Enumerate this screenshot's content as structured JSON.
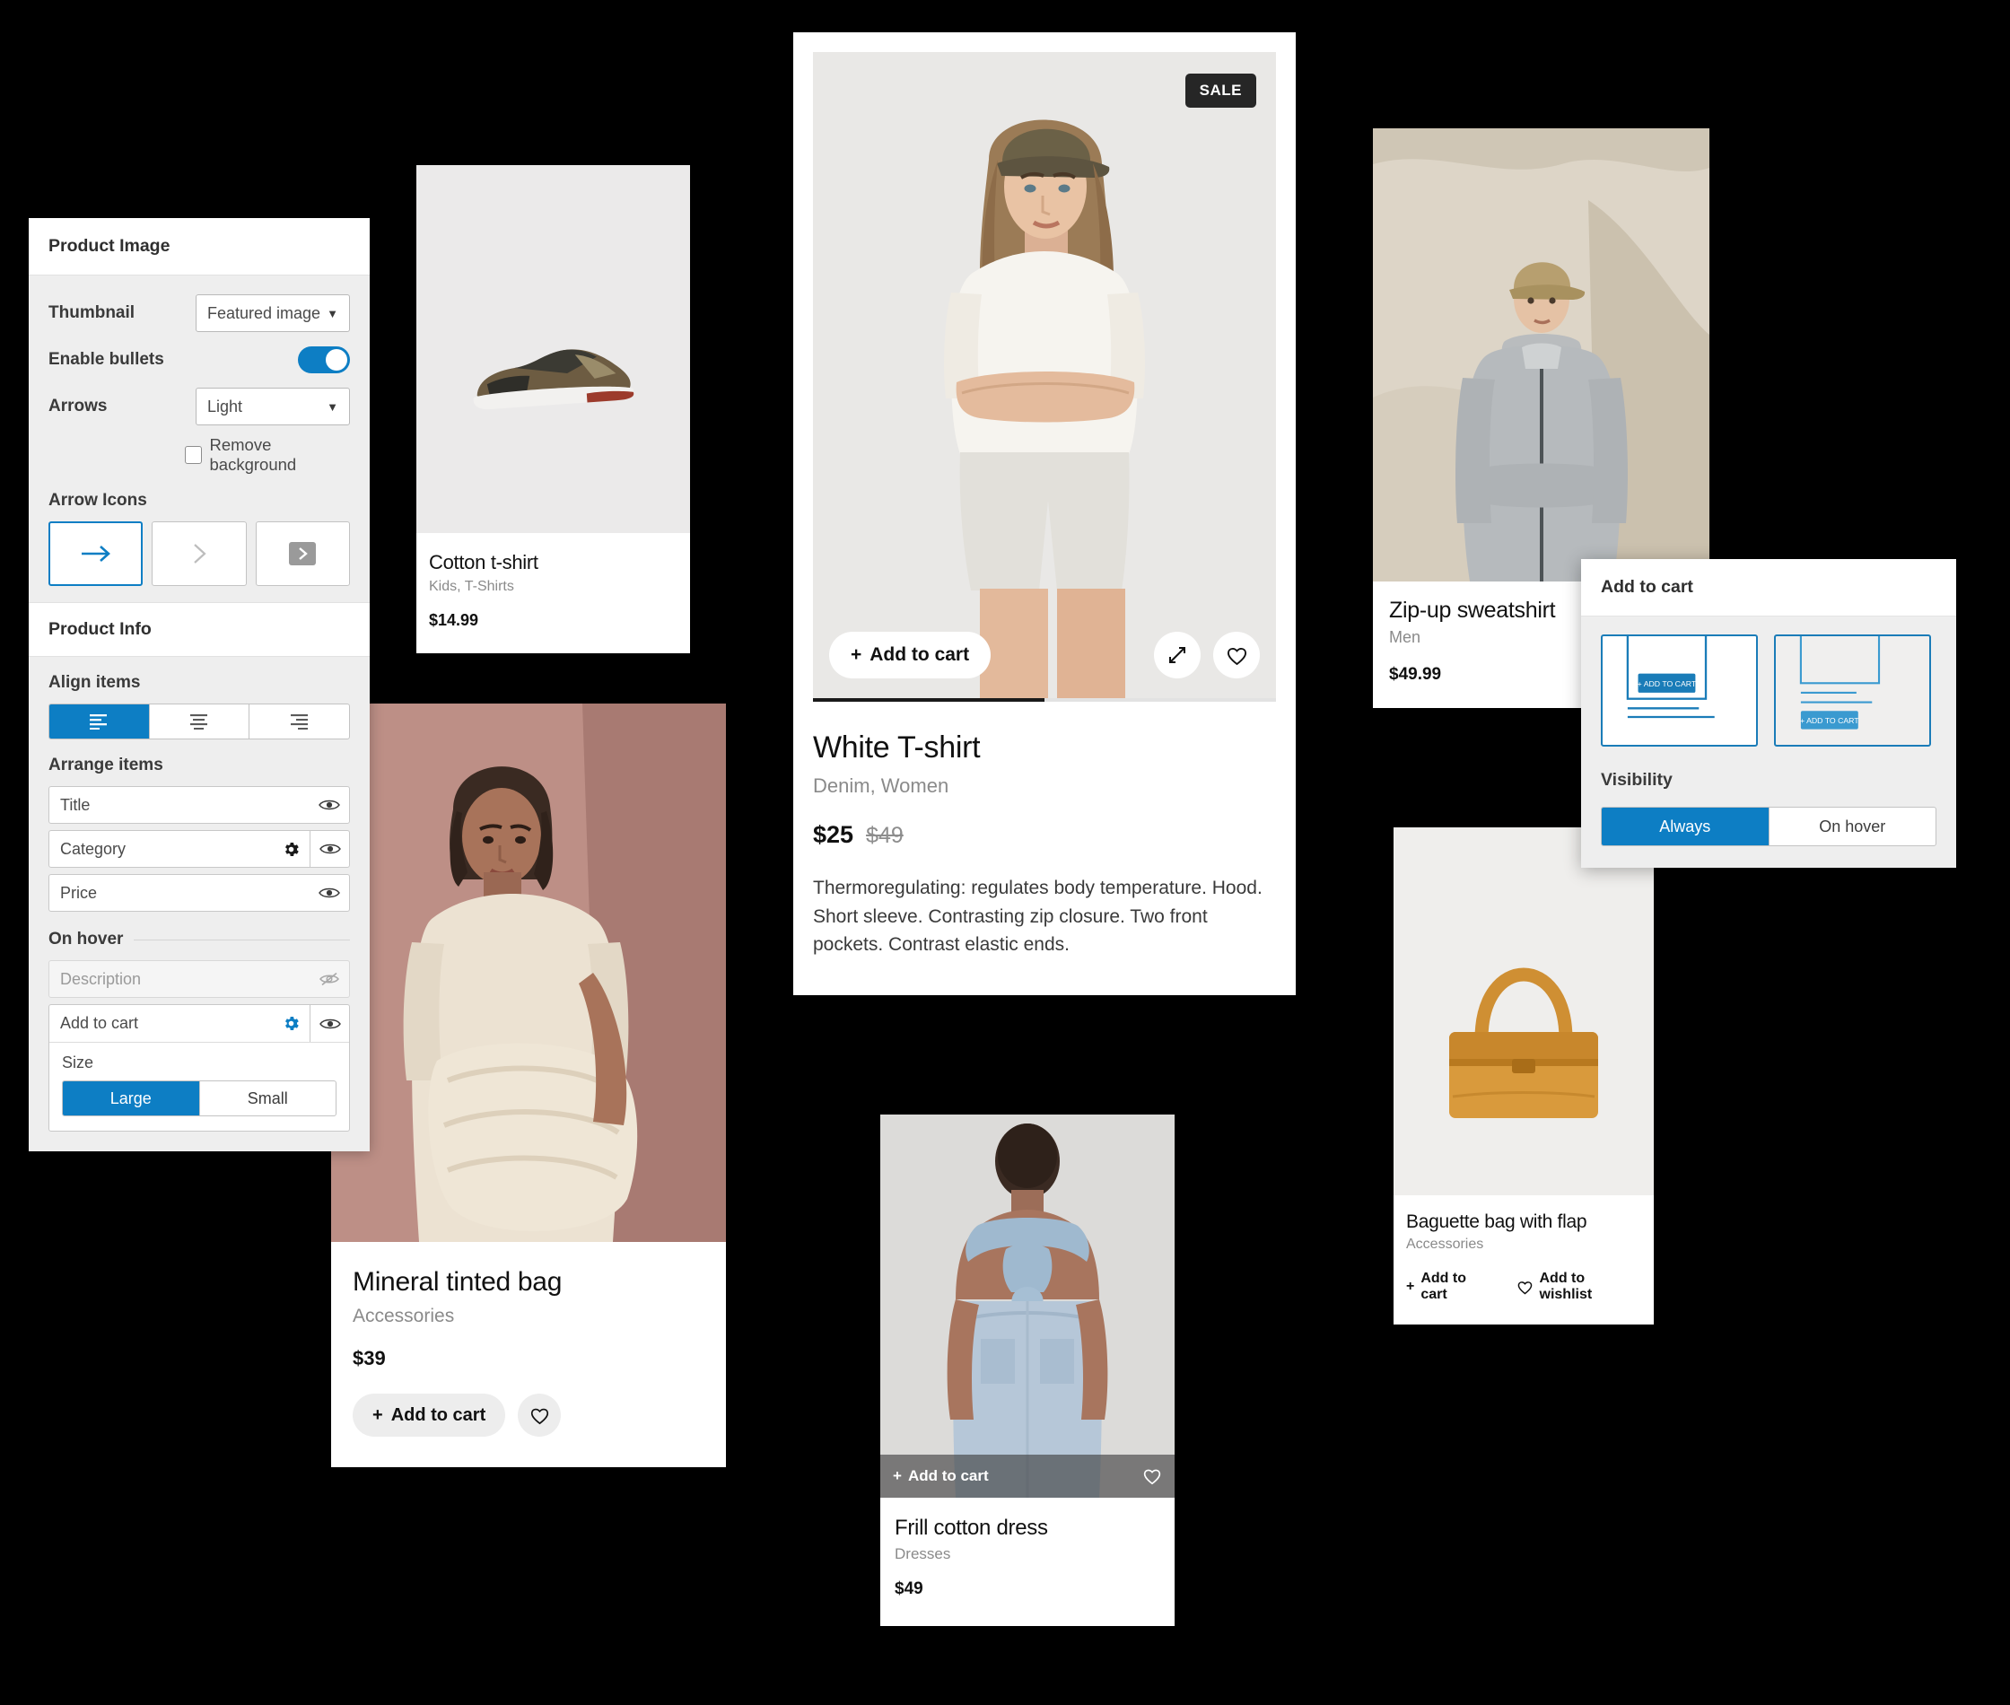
{
  "settings_panel": {
    "header": "Product Image",
    "thumbnail": {
      "label": "Thumbnail",
      "value": "Featured image"
    },
    "enable_bullets": {
      "label": "Enable bullets",
      "state": "on"
    },
    "arrows": {
      "label": "Arrows",
      "value": "Light"
    },
    "remove_background": {
      "label": "Remove background",
      "checked": "false"
    },
    "arrow_icons": {
      "label": "Arrow Icons",
      "options": [
        "long-arrow-right-icon",
        "chevron-right-icon",
        "chevron-right-boxed-icon"
      ],
      "selected_index": 0
    },
    "product_info": {
      "header": "Product Info",
      "align_items": {
        "label": "Align items",
        "options": [
          "align-left-icon",
          "align-center-icon",
          "align-right-icon"
        ],
        "selected_index": 0
      },
      "arrange_items": {
        "label": "Arrange items",
        "items": [
          {
            "name": "Title",
            "has_gear": false,
            "visible": true,
            "dimmed": false
          },
          {
            "name": "Category",
            "has_gear": true,
            "visible": true,
            "dimmed": false
          },
          {
            "name": "Price",
            "has_gear": false,
            "visible": true,
            "dimmed": false
          }
        ]
      },
      "on_hover": {
        "label": "On hover",
        "items": [
          {
            "name": "Description",
            "has_gear": false,
            "visible": false,
            "dimmed": true
          }
        ],
        "add_to_cart": {
          "name": "Add to cart",
          "size_label": "Size",
          "size_options": [
            "Large",
            "Small"
          ],
          "size_selected": "Large"
        }
      }
    }
  },
  "popup": {
    "header": "Add to cart",
    "layout_options": [
      {
        "name": "overlay-on-image-layout",
        "button_label": "+ ADD TO CART",
        "selected": true
      },
      {
        "name": "below-info-layout",
        "button_label": "+ ADD TO CART",
        "selected": false
      }
    ],
    "visibility": {
      "label": "Visibility",
      "options": [
        "Always",
        "On hover"
      ],
      "selected": "Always"
    }
  },
  "products": {
    "cotton_tshirt": {
      "title": "Cotton t-shirt",
      "category": "Kids, T-Shirts",
      "price": "$14.99"
    },
    "white_tshirt": {
      "badge": "SALE",
      "add_to_cart": "Add to cart",
      "title": "White T-shirt",
      "category": "Denim, Women",
      "price": "$25",
      "price_old": "$49",
      "description": "Thermoregulating: regulates body temperature. Hood. Short sleeve. Contrasting zip closure. Two front pockets. Contrast elastic ends."
    },
    "zip_sweatshirt": {
      "title": "Zip-up sweatshirt",
      "category": "Men",
      "price": "$49.99"
    },
    "mineral_bag": {
      "title": "Mineral tinted bag",
      "category": "Accessories",
      "price": "$39",
      "add_to_cart": "Add to cart"
    },
    "frill_dress": {
      "add_to_cart": "Add to cart",
      "title": "Frill cotton dress",
      "category": "Dresses",
      "price": "$49"
    },
    "baguette_bag": {
      "title": "Baguette bag with flap",
      "category": "Accessories",
      "add_to_cart": "Add to cart",
      "add_to_wishlist": "Add to wishlist"
    }
  },
  "colors": {
    "accent": "#0d7ec4",
    "panel_bg": "#eeeeee",
    "badge_bg": "#262626"
  }
}
